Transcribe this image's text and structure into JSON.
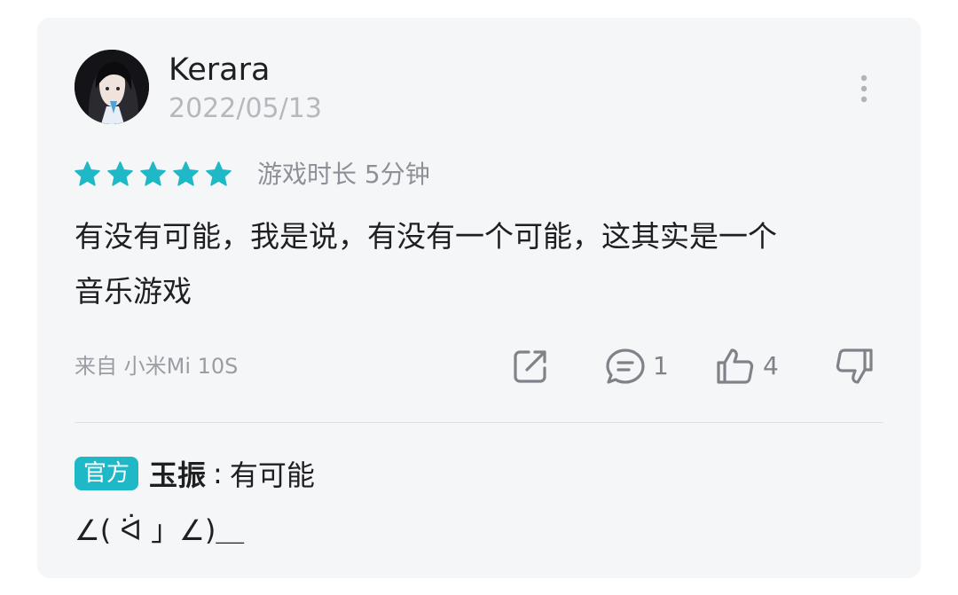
{
  "review": {
    "username": "Kerara",
    "date": "2022/05/13",
    "rating": 5,
    "playtime": "游戏时长 5分钟",
    "content_lines": [
      "有没有可能，我是说，有没有一个可能，这其实是一个",
      "音乐游戏"
    ],
    "device": "来自 小米Mi 10S",
    "comment_count": "1",
    "like_count": "4"
  },
  "reply": {
    "badge": "官方",
    "author": "玉振",
    "separator": ":",
    "text": "有可能",
    "line2": "∠( ᐛ 」∠)＿"
  },
  "colors": {
    "card_bg": "#f5f6f8",
    "star": "#1fb8c6",
    "badge_bg": "#1fb8c6",
    "muted_text": "#b5b8bd",
    "icon": "#7f8288"
  },
  "icons": {
    "more": "more-vertical-icon",
    "share": "share-icon",
    "comment": "comment-icon",
    "like": "thumbs-up-icon",
    "dislike": "thumbs-down-icon",
    "star": "star-icon"
  }
}
